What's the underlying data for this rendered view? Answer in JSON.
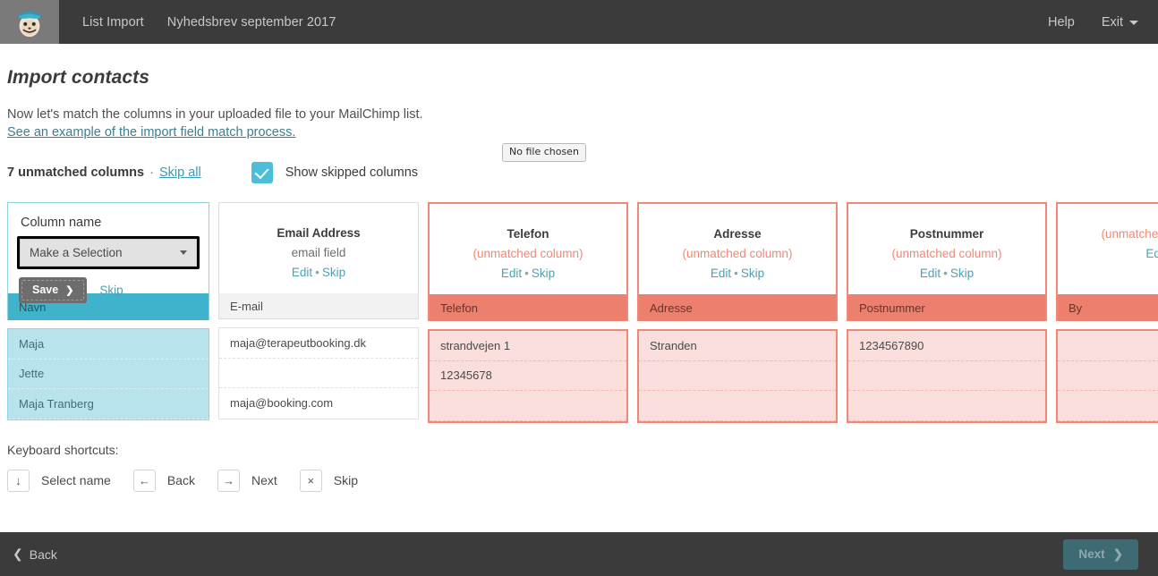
{
  "header": {
    "logo_icon": "mailchimp-freddie-logo",
    "nav": [
      {
        "label": "List Import"
      },
      {
        "label": "Nyhedsbrev september 2017"
      }
    ],
    "help_label": "Help",
    "exit_label": "Exit",
    "exit_caret_icon": "chevron-down-icon"
  },
  "page": {
    "title": "Import contacts",
    "lede": "Now let's match the columns in your uploaded file to your MailChimp list.",
    "lede_link": "See an example of the import field match process."
  },
  "controls": {
    "unmatched_count_text": "7 unmatched columns",
    "separator": "·",
    "skip_all_label": "Skip all",
    "show_skipped_label": "Show skipped columns",
    "checkbox_checked": true,
    "checkbox_icon": "checkmark-icon",
    "no_file_chosen": "No file chosen"
  },
  "first_column": {
    "column_name_label": "Column name",
    "select_value": "Make a Selection",
    "select_caret_icon": "chevron-down-icon",
    "save_label": "Save",
    "save_arrow_icon": "chevron-right-icon",
    "skip_label": "Skip",
    "source_header": "Navn",
    "rows": [
      "Maja",
      "Jette",
      "Maja Tranberg"
    ]
  },
  "columns": [
    {
      "title": "Email Address",
      "subtitle": "email field",
      "unmatched": false,
      "edit_label": "Edit",
      "dot": "•",
      "skip_label": "Skip",
      "source_header": "E-mail",
      "rows": [
        "maja@terapeutbooking.dk",
        "",
        "maja@booking.com"
      ]
    },
    {
      "title": "Telefon",
      "subtitle": "(unmatched column)",
      "unmatched": true,
      "edit_label": "Edit",
      "dot": "•",
      "skip_label": "Skip",
      "source_header": "Telefon",
      "rows": [
        "strandvejen 1",
        "12345678",
        ""
      ]
    },
    {
      "title": "Adresse",
      "subtitle": "(unmatched column)",
      "unmatched": true,
      "edit_label": "Edit",
      "dot": "•",
      "skip_label": "Skip",
      "source_header": "Adresse",
      "rows": [
        "Stranden",
        "",
        ""
      ]
    },
    {
      "title": "Postnummer",
      "subtitle": "(unmatched column)",
      "unmatched": true,
      "edit_label": "Edit",
      "dot": "•",
      "skip_label": "Skip",
      "source_header": "Postnummer",
      "rows": [
        "1234567890",
        "",
        ""
      ]
    },
    {
      "title": "",
      "subtitle": "(unmatched column)",
      "unmatched": true,
      "edit_label": "Edit",
      "dot": "",
      "skip_label": "",
      "source_header": "By",
      "rows": [
        "",
        "",
        ""
      ]
    }
  ],
  "keyboard": {
    "title": "Keyboard shortcuts:",
    "items": [
      {
        "key": "↓",
        "key_icon": "arrow-down-icon",
        "label": "Select name"
      },
      {
        "key": "←",
        "key_icon": "arrow-left-icon",
        "label": "Back"
      },
      {
        "key": "→",
        "key_icon": "arrow-right-icon",
        "label": "Next"
      },
      {
        "key": "×",
        "key_icon": "close-icon",
        "label": "Skip"
      }
    ]
  },
  "footer": {
    "back_label": "Back",
    "back_icon": "chevron-left-icon",
    "next_label": "Next",
    "next_icon": "chevron-right-icon"
  },
  "colors": {
    "teal": "#3fb3cc",
    "teal_light": "#b8e2ec",
    "salmon": "#ec7f6d",
    "salmon_light": "#fadedb",
    "dark": "#3b3b3b",
    "link": "#4e9fb3"
  }
}
